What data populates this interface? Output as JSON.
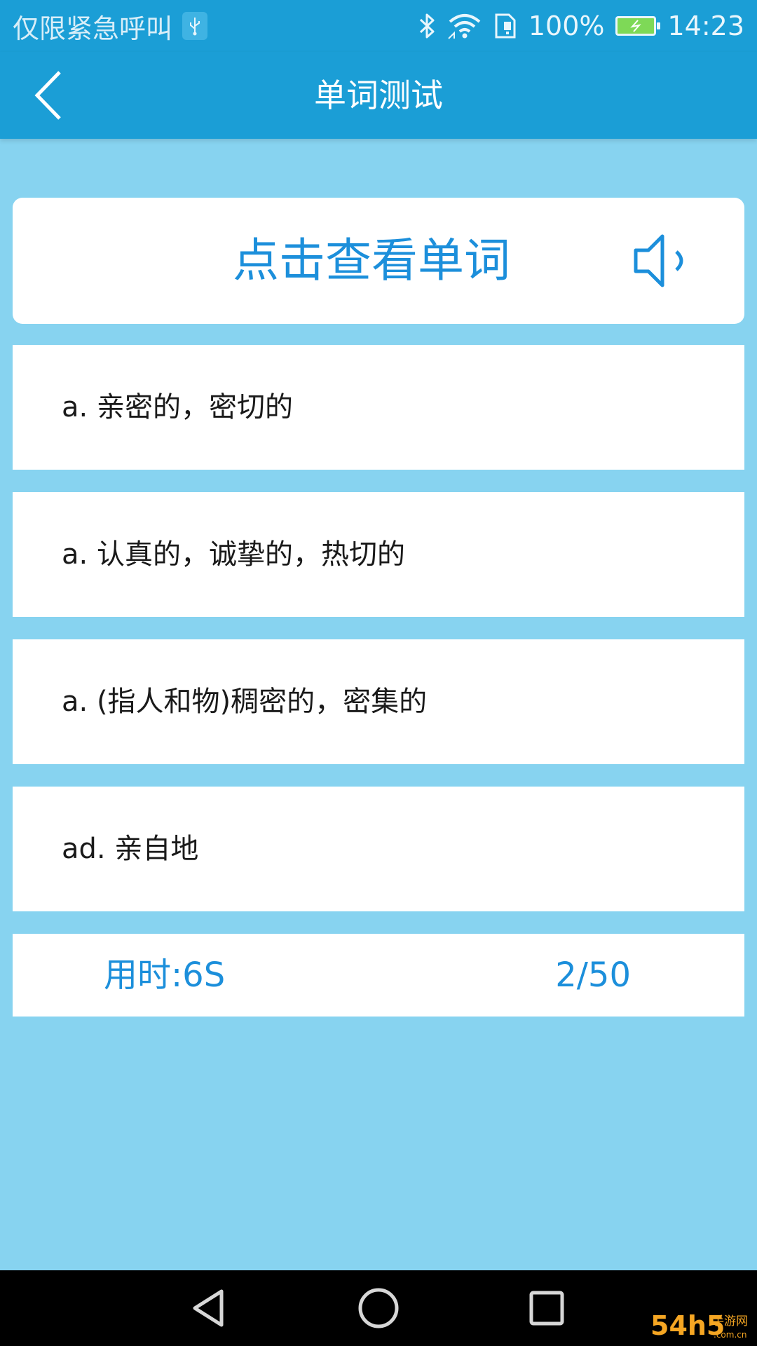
{
  "status_bar": {
    "carrier_text": "仅限紧急呼叫",
    "battery": "100%",
    "time": "14:23"
  },
  "header": {
    "title": "单词测试"
  },
  "quiz": {
    "prompt": "点击查看单词",
    "options": [
      {
        "label": "a. 亲密的，密切的"
      },
      {
        "label": "a. 认真的，诚挚的，热切的"
      },
      {
        "label": "a. (指人和物)稠密的，密集的"
      },
      {
        "label": "ad. 亲自地"
      }
    ]
  },
  "footer": {
    "elapsed": "用时:6S",
    "progress": "2/50"
  },
  "watermark": {
    "brand": "54h5",
    "tagline": "手游网",
    "domain": ".com.cn"
  },
  "icons": {
    "back": "back-arrow-icon",
    "speaker": "speaker-icon",
    "usb": "usb-icon",
    "bluetooth": "bluetooth-icon",
    "wifi": "wifi-icon",
    "sim": "sim-card-icon",
    "battery": "battery-charging-icon",
    "nav_back": "nav-back-icon",
    "nav_home": "nav-home-icon",
    "nav_recents": "nav-recents-icon"
  },
  "colors": {
    "app_bar": "#1b9ed6",
    "background": "#87d3f0",
    "accent_text": "#1c8fdb",
    "card": "#ffffff",
    "battery_fill": "#7ed957"
  }
}
